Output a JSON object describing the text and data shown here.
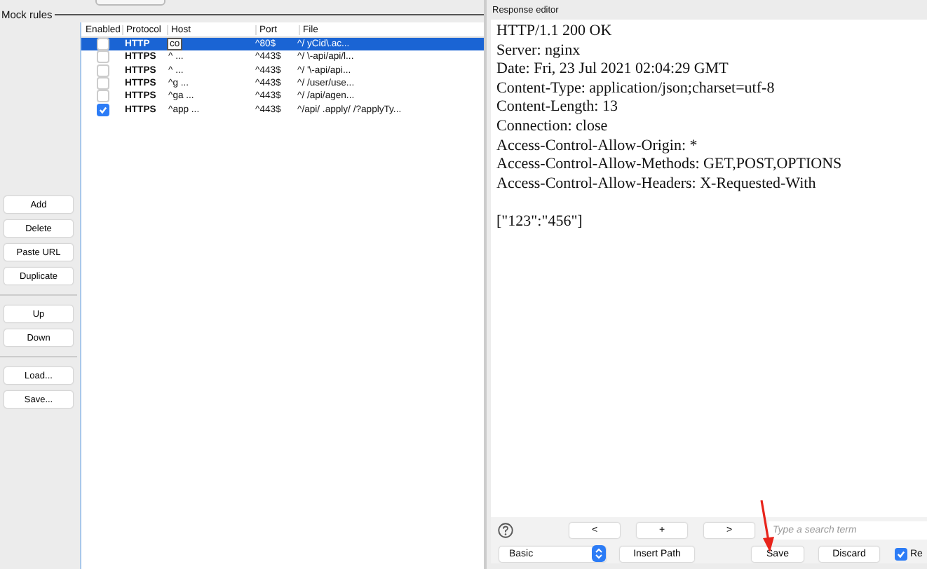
{
  "mock_rules": {
    "title": "Mock rules",
    "columns": [
      "Enabled",
      "Protocol",
      "Host",
      "Port",
      "File"
    ],
    "rows": [
      {
        "enabled": false,
        "selected": true,
        "protocol": "HTTP",
        "host": "co",
        "port": "^80$",
        "file": "^/ yCid\\.ac..."
      },
      {
        "enabled": false,
        "selected": false,
        "protocol": "HTTPS",
        "host": "^ ...",
        "port": "^443$",
        "file": "^/ \\-api/api/l..."
      },
      {
        "enabled": false,
        "selected": false,
        "protocol": "HTTPS",
        "host": "^ ...",
        "port": "^443$",
        "file": "^/ '\\-api/api..."
      },
      {
        "enabled": false,
        "selected": false,
        "protocol": "HTTPS",
        "host": "^g ...",
        "port": "^443$",
        "file": "^/ /user/use..."
      },
      {
        "enabled": false,
        "selected": false,
        "protocol": "HTTPS",
        "host": "^ga ...",
        "port": "^443$",
        "file": "^/ /api/agen..."
      },
      {
        "enabled": true,
        "selected": false,
        "protocol": "HTTPS",
        "host": "^app ...",
        "port": "^443$",
        "file": "^/api/ .apply/ /?applyTy..."
      }
    ],
    "button_groups": [
      [
        "Add",
        "Delete",
        "Paste URL",
        "Duplicate"
      ],
      [
        "Up",
        "Down"
      ],
      [
        "Load...",
        "Save..."
      ]
    ]
  },
  "response_editor": {
    "title": "Response editor",
    "lines": [
      "HTTP/1.1 200 OK",
      "Server: nginx",
      "Date: Fri, 23 Jul 2021 02:04:29 GMT",
      "Content-Type: application/json;charset=utf-8",
      "Content-Length: 13",
      "Connection: close",
      "Access-Control-Allow-Origin: *",
      "Access-Control-Allow-Methods: GET,POST,OPTIONS",
      "Access-Control-Allow-Headers: X-Requested-With"
    ],
    "body": "[\"123\":\"456\"]",
    "nav_buttons": [
      "<",
      "+",
      ">"
    ],
    "search": {
      "placeholder": "Type a search term"
    },
    "mode": "Basic",
    "insert_path": "Insert Path",
    "save": "Save",
    "discard": "Discard",
    "option": {
      "label": "Re",
      "checked": true
    }
  }
}
